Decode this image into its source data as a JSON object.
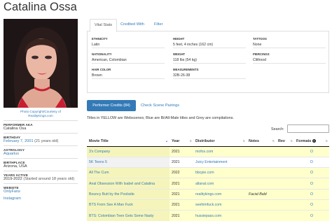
{
  "page": {
    "title": "Catalina Ossa"
  },
  "photo": {
    "alt": "Performer photo",
    "credit_line1": "Photo Copyright/Courtesy of",
    "credit_line2": "RealityKings.com"
  },
  "sidebar": {
    "items": [
      {
        "label": "Performer AKA",
        "value": "Catalina Osa"
      },
      {
        "label": "Birthday",
        "value": "February 7, 2001",
        "extra": "(21 years old)"
      },
      {
        "label": "Astrology",
        "value": "Aquarius"
      },
      {
        "label": "Birthplace",
        "value": "Arizona, USA"
      },
      {
        "label": "Years Active",
        "value": "2019-2022",
        "extra": "(Started around 18 years old)"
      },
      {
        "label": "Website",
        "value": "OnlyFans",
        "value2": "Instagram"
      }
    ]
  },
  "tabs": [
    {
      "label": "Vital Stats"
    },
    {
      "label": "Credited With"
    },
    {
      "label": "Filter"
    }
  ],
  "vitals": [
    {
      "label": "Ethnicity",
      "value": "Latin"
    },
    {
      "label": "Height",
      "value": "5 feet, 4 inches (162 cm)"
    },
    {
      "label": "Tattoos",
      "value": "None"
    },
    {
      "label": "Nationality",
      "value": "American, Colombian"
    },
    {
      "label": "Weight",
      "value": "118 lbs (54 kg)"
    },
    {
      "label": "Piercings",
      "value": "Clithood"
    },
    {
      "label": "Hair Color",
      "value": "Brown"
    },
    {
      "label": "Measurements",
      "value": "32B-26-38"
    }
  ],
  "credits": {
    "button_label": "Performer Credits (84)",
    "pairings_label": "Check Scene Pairings",
    "note": "Titles in YELLOW are Webscenes; Blue are Bi/All-Male titles and Grey are compilations.",
    "search_label": "Search:",
    "search_value": "",
    "columns": [
      "Movie Title",
      "Year",
      "Distributor",
      "Notes",
      "Rev",
      "Formats"
    ],
    "rows": [
      {
        "title": "3's Company",
        "year": "2021",
        "distributor": "mofos.com",
        "notes": "",
        "rev": "",
        "formats": "O",
        "webscene": true
      },
      {
        "title": "5K Teens 5",
        "year": "2021",
        "distributor": "Juicy Entertainment",
        "notes": "",
        "rev": "",
        "formats": "D",
        "webscene": false
      },
      {
        "title": "All The Cum",
        "year": "2022",
        "distributor": "bbcpie.com",
        "notes": "",
        "rev": "",
        "formats": "O",
        "webscene": true
      },
      {
        "title": "Anal Obsession With Isabel and Catalina",
        "year": "2021",
        "distributor": "allanal.com",
        "notes": "",
        "rev": "",
        "formats": "O",
        "webscene": true
      },
      {
        "title": "Bouncy Butt by the Poolside",
        "year": "2021",
        "distributor": "realitykings.com",
        "notes": "Facial Bald",
        "rev": "",
        "formats": "O",
        "webscene": true
      },
      {
        "title": "BTS From See A Man Fuck",
        "year": "2021",
        "distributor": "seehimfuck.com",
        "notes": "",
        "rev": "",
        "formats": "O",
        "webscene": true
      },
      {
        "title": "BTS: Colombian Teen Gets Some Nasty",
        "year": "2021",
        "distributor": "hussiepass.com",
        "notes": "",
        "rev": "",
        "formats": "O",
        "webscene": true
      }
    ]
  },
  "colors": {
    "link": "#337ab7",
    "webscene_row": "#ffffcc",
    "button": "#337ab7"
  }
}
